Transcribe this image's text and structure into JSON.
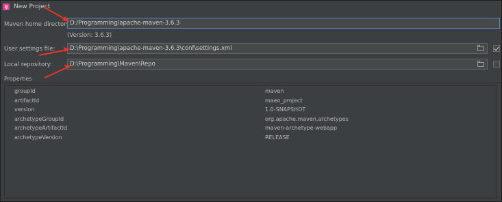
{
  "window": {
    "title": "New Project",
    "app_icon_letters": "IJ"
  },
  "form": {
    "maven_home_label": "Maven home directory:",
    "maven_home_value": "D:/Programming/apache-maven-3.6.3",
    "version_note": "(Version: 3.6.3)",
    "user_settings_label": "User settings file:",
    "user_settings_value": "D:\\Programming\\apache-maven-3.6.3\\conf\\settings.xml",
    "user_settings_override": true,
    "local_repo_label": "Local repository:",
    "local_repo_value": "D:\\Programming\\Maven\\Repo",
    "local_repo_override": false
  },
  "properties": {
    "header": "Properties",
    "rows": [
      {
        "key": "groupId",
        "value": "maven"
      },
      {
        "key": "artifactId",
        "value": "maen_project"
      },
      {
        "key": "version",
        "value": "1.0-SNAPSHOT"
      },
      {
        "key": "archetypeGroupId",
        "value": "org.apache.maven.archetypes"
      },
      {
        "key": "archetypeArtifactId",
        "value": "maven-archetype-webapp"
      },
      {
        "key": "archetypeVersion",
        "value": "RELEASE"
      }
    ]
  },
  "colors": {
    "background": "#3c3f41",
    "field_background": "#45494a",
    "annotation_arrow": "#e8352b"
  }
}
